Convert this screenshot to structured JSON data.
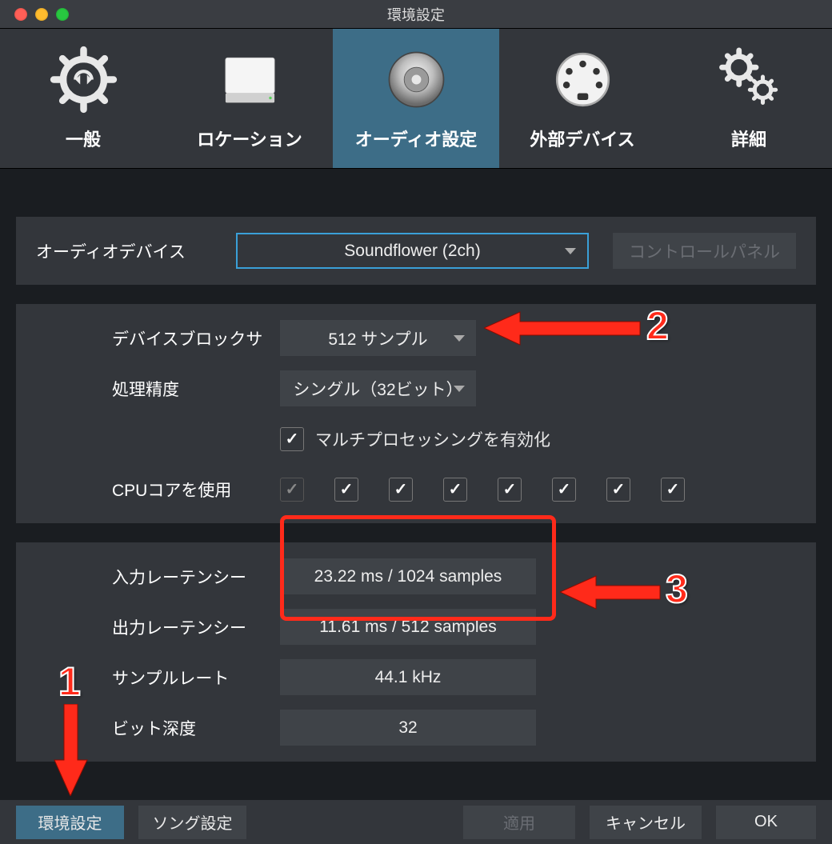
{
  "window": {
    "title": "環境設定"
  },
  "tabs": {
    "general": "一般",
    "location": "ロケーション",
    "audio": "オーディオ設定",
    "external": "外部デバイス",
    "advanced": "詳細"
  },
  "device_panel": {
    "label": "オーディオデバイス",
    "device_selected": "Soundflower (2ch)",
    "control_panel_btn": "コントロールパネル"
  },
  "processing_panel": {
    "block_label": "デバイスブロックサ",
    "block_value": "512 サンプル",
    "precision_label": "処理精度",
    "precision_value": "シングル（32ビット）",
    "multiproc_label": "マルチプロセッシングを有効化",
    "cpu_label": "CPUコアを使用",
    "cpu_cores": [
      true,
      true,
      true,
      true,
      true,
      true,
      true,
      true
    ],
    "cpu_first_dim": true
  },
  "latency_panel": {
    "in_label": "入力レーテンシー",
    "in_value": "23.22 ms / 1024 samples",
    "out_label": "出力レーテンシー",
    "out_value": "11.61 ms / 512 samples",
    "rate_label": "サンプルレート",
    "rate_value": "44.1 kHz",
    "depth_label": "ビット深度",
    "depth_value": "32"
  },
  "footer": {
    "env_settings": "環境設定",
    "song_settings": "ソング設定",
    "apply": "適用",
    "cancel": "キャンセル",
    "ok": "OK"
  },
  "annotations": {
    "n1": "1",
    "n2": "2",
    "n3": "3"
  }
}
